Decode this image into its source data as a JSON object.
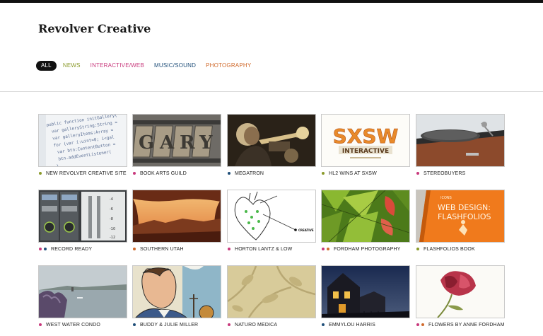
{
  "site": {
    "title": "Revolver Creative"
  },
  "colors": {
    "news": "#8a9a2a",
    "interactive": "#c8397c",
    "music": "#1f4e79",
    "photography": "#d06a2c",
    "active_bg": "#111111"
  },
  "filters": [
    {
      "label": "ALL",
      "active": true,
      "color": "#ffffff"
    },
    {
      "label": "NEWS",
      "active": false,
      "color": "#8a9a2a"
    },
    {
      "label": "INTERACTIVE/WEB",
      "active": false,
      "color": "#c8397c"
    },
    {
      "label": "MUSIC/SOUND",
      "active": false,
      "color": "#1f4e79"
    },
    {
      "label": "PHOTOGRAPHY",
      "active": false,
      "color": "#d06a2c"
    }
  ],
  "tiles": [
    {
      "label": "NEW REVOLVER CREATIVE SITE",
      "dots": [
        "#8a9a2a"
      ],
      "thumb": "code-icon"
    },
    {
      "label": "BOOK ARTS GUILD",
      "dots": [
        "#c8397c"
      ],
      "thumb": "letterpress-icon"
    },
    {
      "label": "MEGATRON",
      "dots": [
        "#1f4e79"
      ],
      "thumb": "trumpet-player-icon"
    },
    {
      "label": "HL2 WINS AT SXSW",
      "dots": [
        "#8a9a2a"
      ],
      "thumb": "sxsw-logo-icon",
      "thumb_text": [
        "SXSW",
        "INTERACTIVE"
      ]
    },
    {
      "label": "STEREOBUYERS",
      "dots": [
        "#c8397c"
      ],
      "thumb": "turntable-icon"
    },
    {
      "label": "RECORD READY",
      "dots": [
        "#c8397c",
        "#1f4e79"
      ],
      "thumb": "mixer-icon"
    },
    {
      "label": "SOUTHERN UTAH",
      "dots": [
        "#d06a2c"
      ],
      "thumb": "canyon-icon"
    },
    {
      "label": "HORTON LANTZ & LOW",
      "dots": [
        "#c8397c"
      ],
      "thumb": "heart-diagram-icon",
      "thumb_text": [
        "CREATIVE"
      ]
    },
    {
      "label": "FORDHAM PHOTOGRAPHY",
      "dots": [
        "#c8397c",
        "#d06a2c"
      ],
      "thumb": "leaves-icon"
    },
    {
      "label": "FLASHFOLIOS BOOK",
      "dots": [
        "#8a9a2a"
      ],
      "thumb": "book-cover-icon",
      "thumb_text": [
        "WEB DESIGN:",
        "FLASHFOLIOS"
      ]
    },
    {
      "label": "WEST WATER CONDO",
      "dots": [
        "#c8397c"
      ],
      "thumb": "waterfront-icon"
    },
    {
      "label": "BUDDY & JULIE MILLER",
      "dots": [
        "#1f4e79"
      ],
      "thumb": "illustration-icon"
    },
    {
      "label": "NATURO MEDICA",
      "dots": [
        "#c8397c"
      ],
      "thumb": "botanical-icon"
    },
    {
      "label": "EMMYLOU HARRIS",
      "dots": [
        "#1f4e79"
      ],
      "thumb": "night-house-icon"
    },
    {
      "label": "FLOWERS BY ANNE FORDHAM",
      "dots": [
        "#c8397c",
        "#d06a2c"
      ],
      "thumb": "tulip-icon"
    }
  ]
}
